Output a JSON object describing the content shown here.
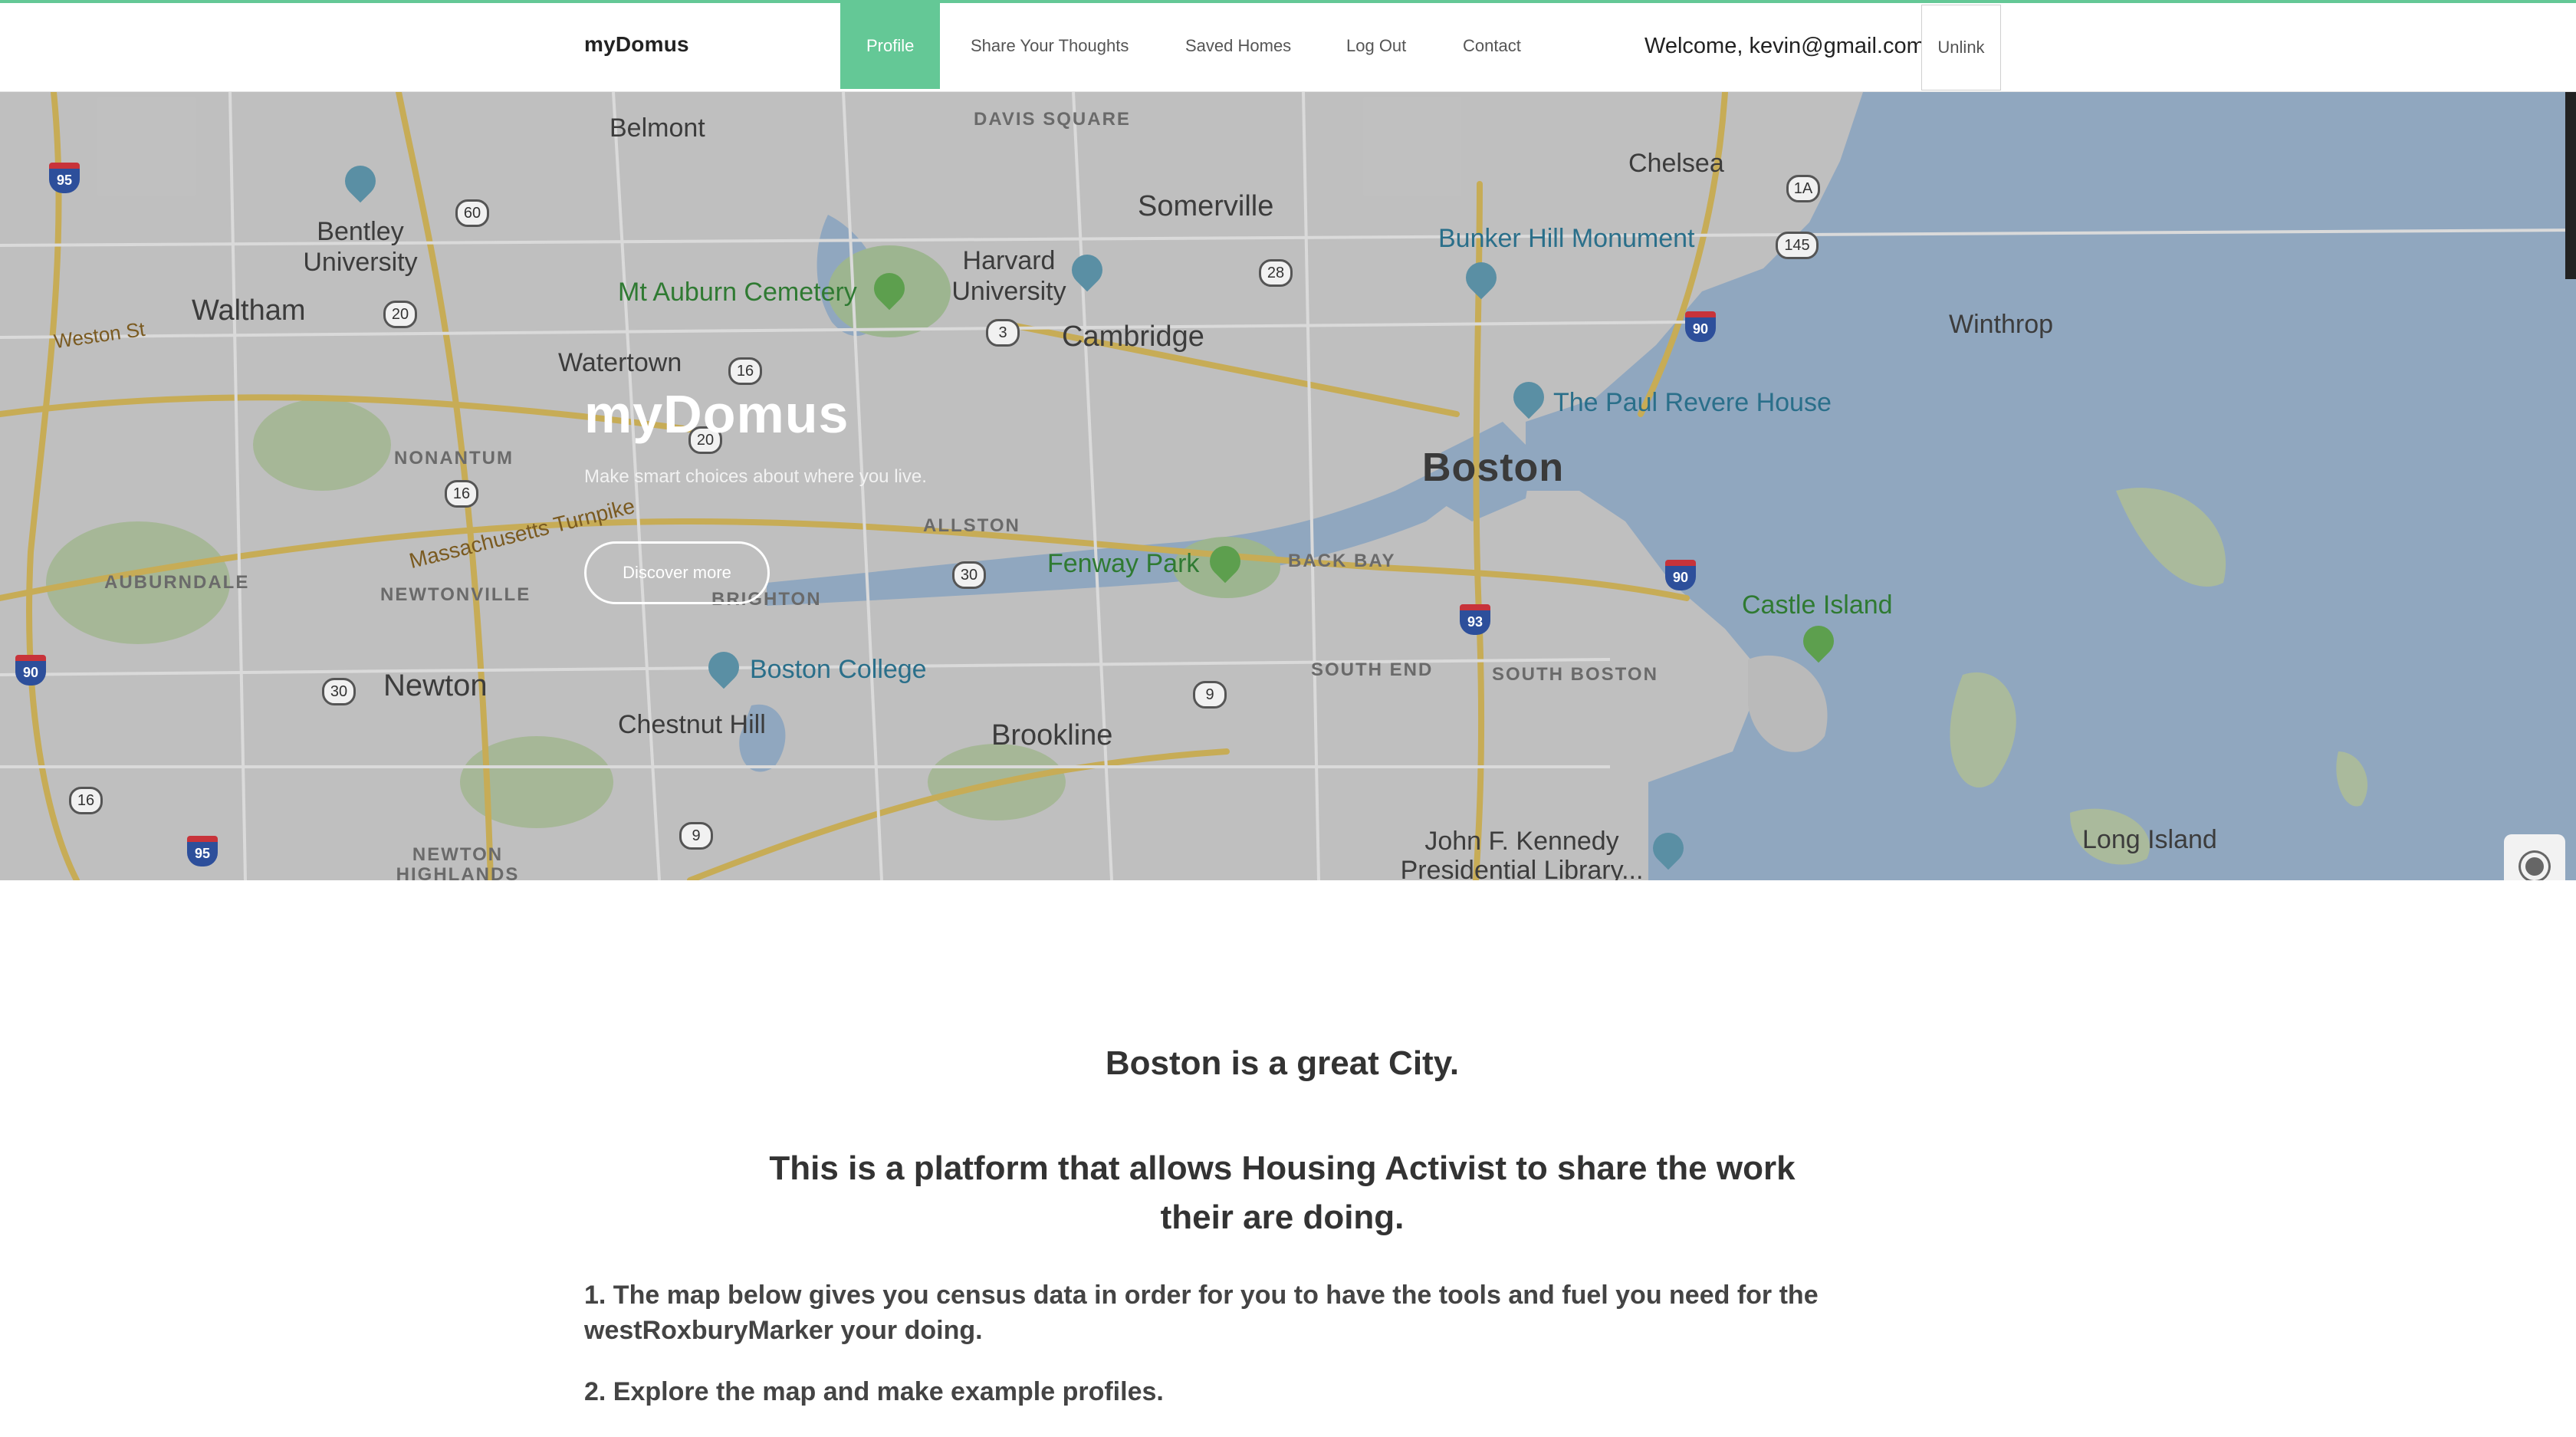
{
  "navbar": {
    "brand": "myDomus",
    "items": [
      {
        "label": "Profile",
        "active": true
      },
      {
        "label": "Share Your Thoughts",
        "active": false
      },
      {
        "label": "Saved Homes",
        "active": false
      },
      {
        "label": "Log Out",
        "active": false
      },
      {
        "label": "Contact",
        "active": false
      }
    ],
    "welcome": "Welcome, kevin@gmail.com",
    "unlink_label": "Unlink",
    "accent_color": "#64c896"
  },
  "hero": {
    "title": "myDomus",
    "subtitle": "Make smart choices about where you live.",
    "discover_label": "Discover more"
  },
  "map": {
    "places": [
      "Belmont",
      "DAVIS SQUARE",
      "Somerville",
      "Chelsea",
      "Bentley University",
      "Harvard University",
      "Mt Auburn Cemetery",
      "Bunker Hill Monument",
      "Waltham",
      "Weston St",
      "Cambridge",
      "Watertown",
      "Winthrop",
      "The Paul Revere House",
      "NONANTUM",
      "Boston",
      "Massachusetts Turnpike",
      "ALLSTON",
      "Fenway Park",
      "BACK BAY",
      "AUBURNDALE",
      "NEWTONVILLE",
      "BRIGHTON",
      "Castle Island",
      "Boston College",
      "Newton",
      "SOUTH END",
      "SOUTH BOSTON",
      "Chestnut Hill",
      "Brookline",
      "John F. Kennedy Presidential Library...",
      "Long Island",
      "NEWTON HIGHLANDS"
    ],
    "route_shields": [
      "95",
      "60",
      "20",
      "16",
      "3",
      "28",
      "1A",
      "145",
      "90",
      "20",
      "16",
      "30",
      "90",
      "93",
      "90",
      "30",
      "9",
      "16",
      "95",
      "9"
    ]
  },
  "content": {
    "heading1": "Boston is a great City.",
    "heading2": "This is a platform that allows Housing Activist to share the work their are doing.",
    "point1": "1. The map below gives you census data in order for you to have the tools and fuel you need for the westRoxburyMarker your doing.",
    "point2": "2. Explore the map and make example profiles."
  }
}
